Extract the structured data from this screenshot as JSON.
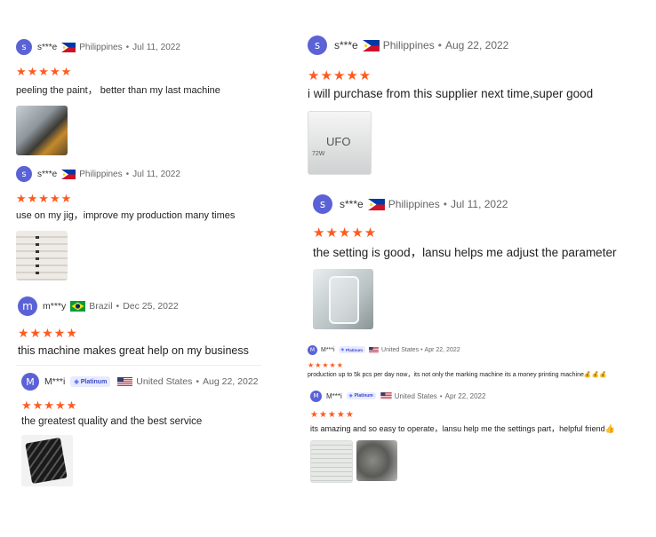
{
  "reviews": [
    {
      "name": "s***e",
      "avatar": "s",
      "country": "Philippines",
      "date": "Jul 11, 2022",
      "stars": "★★★★★",
      "text": "peeling the paint， better than my last machine"
    },
    {
      "name": "s***e",
      "avatar": "s",
      "country": "Philippines",
      "date": "Jul 11, 2022",
      "stars": "★★★★★",
      "text": "use on my jig，improve my production many times"
    },
    {
      "name": "m***y",
      "avatar": "m",
      "country": "Brazil",
      "date": "Dec 25, 2022",
      "stars": "★★★★★",
      "text": "this machine makes great help on my business"
    },
    {
      "name": "M***i",
      "avatar": "M",
      "badge": "Platinum",
      "country": "United States",
      "date": "Aug 22, 2022",
      "stars": "★★★★★",
      "text": "the greatest quality and the best service"
    },
    {
      "name": "s***e",
      "avatar": "s",
      "country": "Philippines",
      "date": "Aug 22, 2022",
      "stars": "★★★★★",
      "text": "i will purchase from this supplier next time,super good",
      "image_text": "UFO",
      "image_sub": "72W"
    },
    {
      "name": "s***e",
      "avatar": "s",
      "country": "Philippines",
      "date": "Jul 11, 2022",
      "stars": "★★★★★",
      "text": "the setting is good，lansu helps me adjust the parameter"
    },
    {
      "name": "M***i",
      "avatar": "M",
      "badge": "Platinum",
      "country": "United States",
      "date": "Apr 22, 2022",
      "stars": "★★★★★",
      "text": "production up to 5k pcs per day now，its not only the marking machine its a money printing machine💰💰💰"
    },
    {
      "name": "M***i",
      "avatar": "M",
      "badge": "Platinum",
      "country": "United States",
      "date": "Apr 22, 2022",
      "stars": "★★★★★",
      "text": "its amazing and so easy to operate，lansu help me the settings part，helpful friend👍"
    }
  ],
  "colors": {
    "avatar": "#5a62d6",
    "star": "#ff5a1f",
    "badge_bg": "#e8ebff"
  }
}
